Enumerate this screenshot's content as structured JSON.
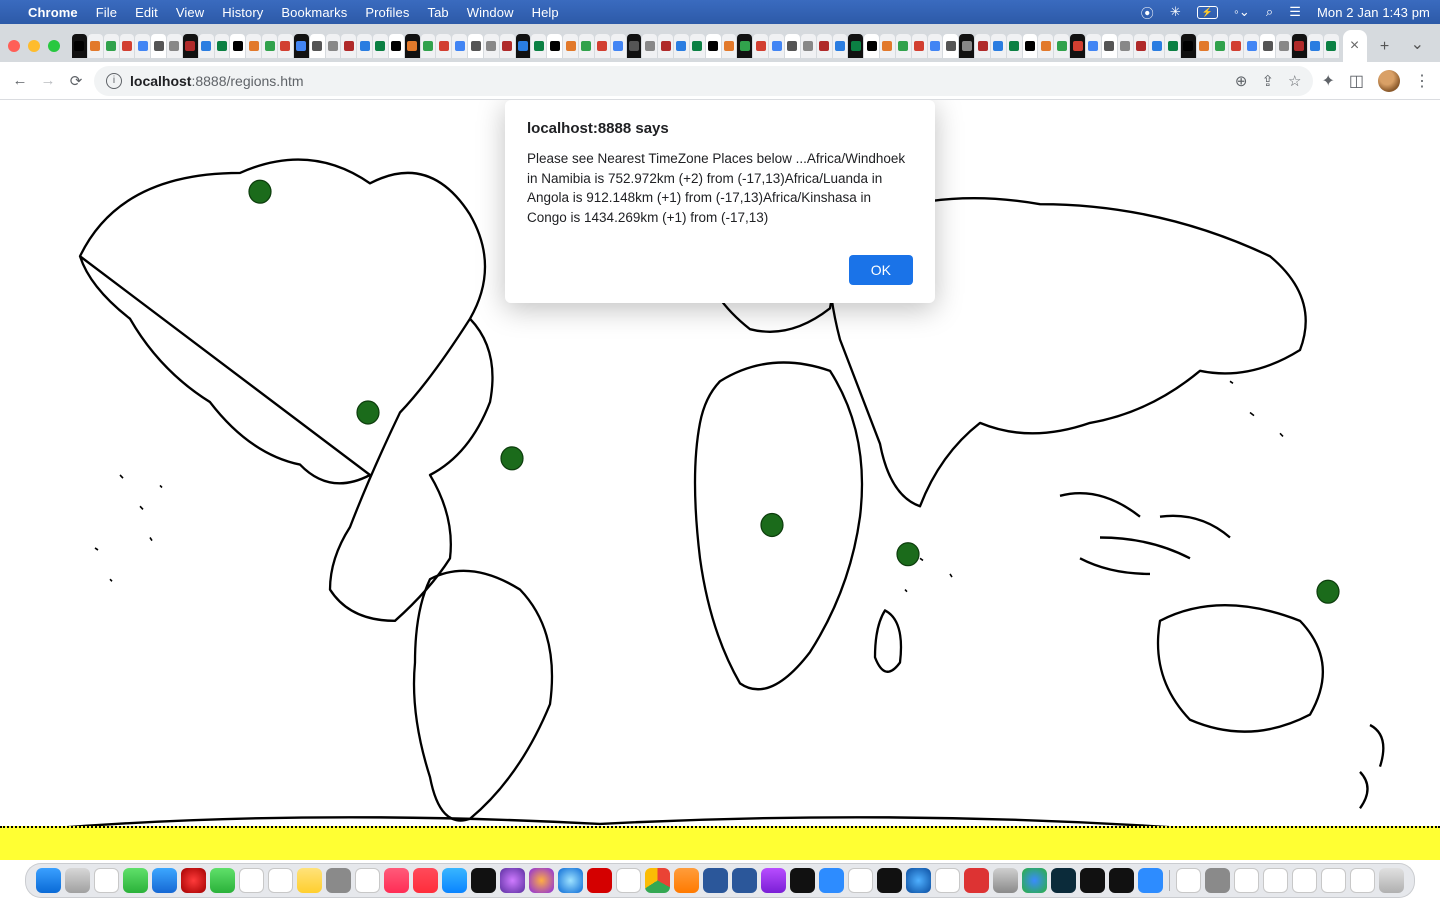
{
  "menubar": {
    "app_name": "Chrome",
    "items": [
      "File",
      "Edit",
      "View",
      "History",
      "Bookmarks",
      "Profiles",
      "Tab",
      "Window",
      "Help"
    ],
    "clock": "Mon 2 Jan  1:43 pm"
  },
  "browser": {
    "url_host": "localhost",
    "url_rest": ":8888/regions.htm",
    "tab_close_glyph": "×",
    "newtab_glyph": "+",
    "dropdown_glyph": "⌄"
  },
  "dialog": {
    "title": "localhost:8888 says",
    "body": "Please see Nearest TimeZone Places below ...Africa/Windhoek in Namibia is 752.972km (+2) from  (-17,13)Africa/Luanda in Angola is 912.148km (+1) from  (-17,13)Africa/Kinshasa in Congo is 1434.269km (+1) from  (-17,13)",
    "ok_label": "OK",
    "nearest": [
      {
        "tz": "Africa/Windhoek",
        "country": "Namibia",
        "distance_km": 752.972,
        "utc_offset": "+2",
        "from_point": "(-17,13)"
      },
      {
        "tz": "Africa/Luanda",
        "country": "Angola",
        "distance_km": 912.148,
        "utc_offset": "+1",
        "from_point": "(-17,13)"
      },
      {
        "tz": "Africa/Kinshasa",
        "country": "Congo",
        "distance_km": 1434.269,
        "utc_offset": "+1",
        "from_point": "(-17,13)"
      }
    ]
  },
  "map_markers": [
    {
      "label": "nw-canada",
      "lon": -115,
      "lat": 68
    },
    {
      "label": "c-america",
      "lon": -88,
      "lat": 15
    },
    {
      "label": "ne-brazil",
      "lon": -52,
      "lat": 4
    },
    {
      "label": "angola",
      "lon": 13,
      "lat": -12
    },
    {
      "label": "madagascar",
      "lon": 47,
      "lat": -19
    },
    {
      "label": "e-australia",
      "lon": 152,
      "lat": -28
    }
  ],
  "dock_apps": [
    {
      "name": "finder",
      "bg": "linear-gradient(#3aa0ff,#0a6ad6)"
    },
    {
      "name": "launchpad",
      "bg": "linear-gradient(#d7d7d7,#a0a0a0)"
    },
    {
      "name": "calendar-mini",
      "bg": "#fff"
    },
    {
      "name": "messages",
      "bg": "linear-gradient(#5fe06a,#2bb13a)"
    },
    {
      "name": "mail",
      "bg": "linear-gradient(#3ca7ff,#1668d4)"
    },
    {
      "name": "opera",
      "bg": "radial-gradient(circle,#ff3b3b,#a30000)"
    },
    {
      "name": "facetime",
      "bg": "linear-gradient(#5fe06a,#2bb13a)"
    },
    {
      "name": "photos",
      "bg": "#fff"
    },
    {
      "name": "calendar",
      "bg": "#fff"
    },
    {
      "name": "notes",
      "bg": "linear-gradient(#ffe27a,#ffcf2e)"
    },
    {
      "name": "contacts",
      "bg": "#8a8a8a"
    },
    {
      "name": "reminders",
      "bg": "#fff"
    },
    {
      "name": "music",
      "bg": "linear-gradient(#ff5a7a,#ff2d55)"
    },
    {
      "name": "news",
      "bg": "linear-gradient(#ff4a5a,#ff2d3b)"
    },
    {
      "name": "appstore",
      "bg": "linear-gradient(#38b6ff,#0a84ff)"
    },
    {
      "name": "appletv",
      "bg": "#111"
    },
    {
      "name": "art",
      "bg": "radial-gradient(circle,#cf7bff,#5a2fa0)"
    },
    {
      "name": "firefox",
      "bg": "radial-gradient(circle,#ffae42,#8a2be2)"
    },
    {
      "name": "safari",
      "bg": "radial-gradient(circle,#9fe3ff,#0a6ad6)"
    },
    {
      "name": "filezilla",
      "bg": "#d40000"
    },
    {
      "name": "bold",
      "bg": "#fff"
    },
    {
      "name": "chrome",
      "bg": "conic-gradient(#ea4335 0 33%,#34a853 33% 66%,#fbbc05 66% 100%)"
    },
    {
      "name": "books",
      "bg": "linear-gradient(#ff9d3b,#ff7a00)"
    },
    {
      "name": "word1",
      "bg": "#2b579a"
    },
    {
      "name": "word2",
      "bg": "#2b579a"
    },
    {
      "name": "podcasts",
      "bg": "linear-gradient(#b84dff,#7a1fd6)"
    },
    {
      "name": "voicememos",
      "bg": "#111"
    },
    {
      "name": "zoom",
      "bg": "#2d8cff"
    },
    {
      "name": "preview",
      "bg": "#fff"
    },
    {
      "name": "terminal1",
      "bg": "#111"
    },
    {
      "name": "earth",
      "bg": "radial-gradient(circle,#4fb0ff,#0a4da0)"
    },
    {
      "name": "chart",
      "bg": "#fff"
    },
    {
      "name": "red-util",
      "bg": "#d33"
    },
    {
      "name": "settings",
      "bg": "linear-gradient(#cfcfcf,#8a8a8a)"
    },
    {
      "name": "findmy",
      "bg": "radial-gradient(circle,#3a8bff,#2bb13a)"
    },
    {
      "name": "dashlane",
      "bg": "#0b2b3a"
    },
    {
      "name": "terminal2",
      "bg": "#111"
    },
    {
      "name": "intellij",
      "bg": "#111"
    },
    {
      "name": "xcode",
      "bg": "#2d8cff"
    },
    {
      "name": "sep",
      "sep": true
    },
    {
      "name": "doc1",
      "bg": "#fff"
    },
    {
      "name": "doc2",
      "bg": "#8a8a8a"
    },
    {
      "name": "doc3",
      "bg": "#fff"
    },
    {
      "name": "doc4",
      "bg": "#fff"
    },
    {
      "name": "doc5",
      "bg": "#fff"
    },
    {
      "name": "doc6",
      "bg": "#fff"
    },
    {
      "name": "doc7",
      "bg": "#fff"
    },
    {
      "name": "trash",
      "bg": "linear-gradient(#e0e0e0,#b0b0b0)"
    }
  ]
}
